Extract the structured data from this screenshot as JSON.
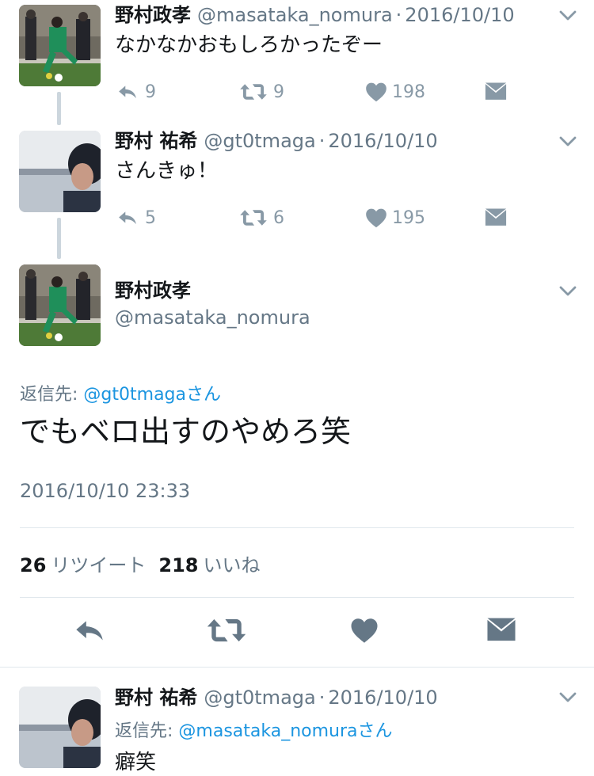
{
  "tweets": [
    {
      "name": "野村政孝",
      "handle": "@masataka_nomura",
      "separator": "·",
      "date": "2016/10/10",
      "text": "なかなかおもしろかったぞー",
      "reply_count": "9",
      "retweet_count": "9",
      "like_count": "198"
    },
    {
      "name": "野村 祐希",
      "handle": "@gt0tmaga",
      "separator": "·",
      "date": "2016/10/10",
      "text": "さんきゅ！",
      "reply_count": "5",
      "retweet_count": "6",
      "like_count": "195"
    }
  ],
  "focused": {
    "name": "野村政孝",
    "handle": "@masataka_nomura",
    "reply_to_label": "返信先:",
    "reply_to_handle": "@gt0tmagaさん",
    "text": "でもベロ出すのやめろ笑",
    "timestamp": "2016/10/10 23:33",
    "retweet_count": "26",
    "retweet_label": "リツイート",
    "like_count": "218",
    "like_label": "いいね"
  },
  "reply": {
    "name": "野村 祐希",
    "handle": "@gt0tmaga",
    "separator": "·",
    "date": "2016/10/10",
    "reply_to_label": "返信先:",
    "reply_to_handle": "@masataka_nomuraさん",
    "text": "癖笑"
  },
  "icons": [
    "reply-icon",
    "retweet-icon",
    "heart-icon",
    "direct-message-icon",
    "chevron-down-icon"
  ],
  "colors": {
    "muted": "#657786",
    "icon": "#8899a6",
    "link": "#1b95e0",
    "divider": "#e1e8ed"
  }
}
